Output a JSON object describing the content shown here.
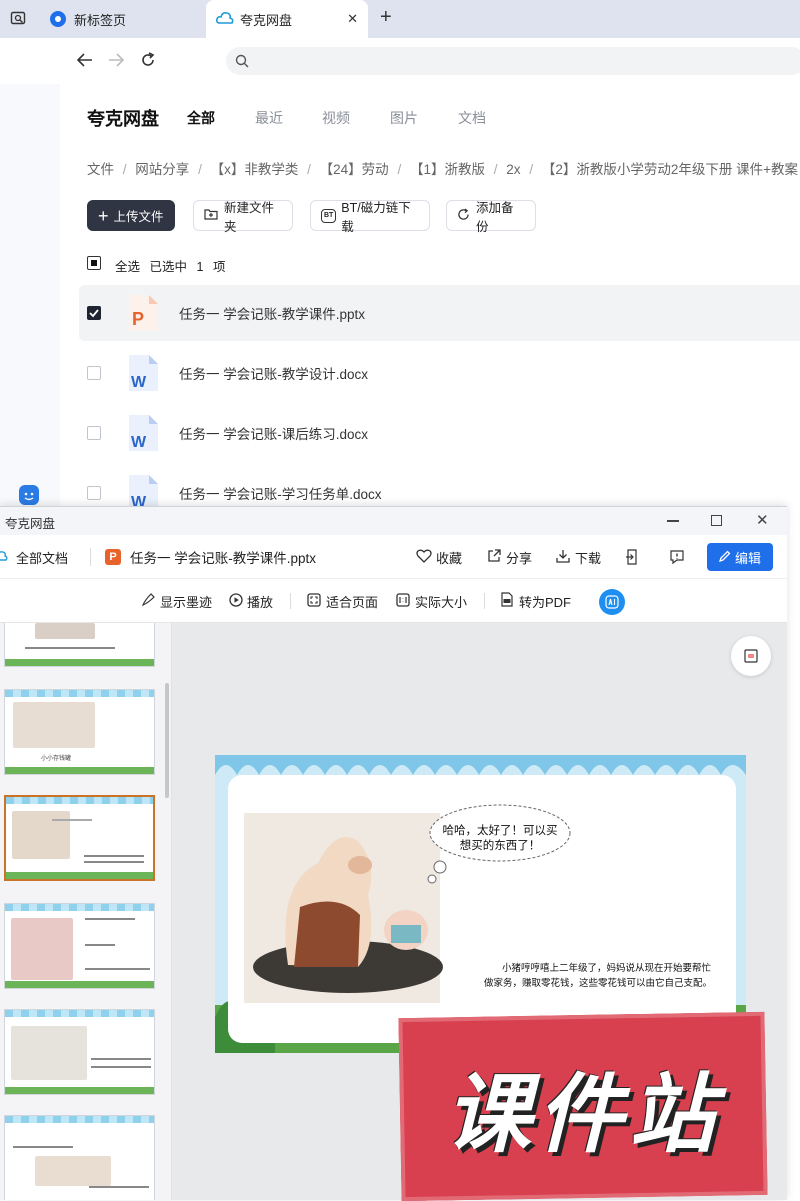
{
  "browser": {
    "tabs": [
      {
        "label": "新标签页"
      },
      {
        "label": "夸克网盘",
        "active": true
      }
    ],
    "new_tab_symbol": "+",
    "close_symbol": "✕"
  },
  "app": {
    "logo": "夸克网盘",
    "nav_tabs": [
      "全部",
      "最近",
      "视频",
      "图片",
      "文档"
    ],
    "active_tab": "全部",
    "breadcrumb": [
      "文件",
      "网站分享",
      "【x】非教学类",
      "【24】劳动",
      "【1】浙教版",
      "2x",
      "【2】浙教版小学劳动2年级下册 课件+教案"
    ],
    "breadcrumb_sep": "/",
    "actions": {
      "upload": "上传文件",
      "new_folder": "新建文件夹",
      "bt_download": "BT/磁力链下载",
      "add_backup": "添加备份"
    },
    "selection": {
      "select_all": "全选",
      "selected_prefix": "已选中",
      "count": "1",
      "unit": "项"
    },
    "files": [
      {
        "name": "任务一 学会记账-教学课件.pptx",
        "type": "pptx",
        "checked": true
      },
      {
        "name": "任务一 学会记账-教学设计.docx",
        "type": "docx",
        "checked": false
      },
      {
        "name": "任务一 学会记账-课后练习.docx",
        "type": "docx",
        "checked": false
      },
      {
        "name": "任务一 学会记账-学习任务单.docx",
        "type": "docx",
        "checked": false
      }
    ]
  },
  "viewer": {
    "window_title": "夸克网盘",
    "all_docs": "全部文档",
    "file_name": "任务一 学会记账-教学课件.pptx",
    "top_actions": {
      "favorite": "收藏",
      "share": "分享",
      "download": "下载",
      "edit": "编辑"
    },
    "tools": {
      "ink": "显示墨迹",
      "play": "播放",
      "fit_page": "适合页面",
      "actual_size": "实际大小",
      "to_pdf": "转为PDF"
    },
    "thumb_captions": [
      "小小存钱罐"
    ],
    "slide": {
      "bubble": "哈哈，太好了！可以买想买的东西了！",
      "body": "小猪哼哼嘻上二年级了，妈妈说从现在开始要帮忙做家务，赚取零花钱，这些零花钱可以由它自己支配。"
    },
    "watermark": "课件站"
  },
  "colors": {
    "accent": "#1f6feb",
    "upload_btn": "#2f3542",
    "tab_bar": "#dee3ef",
    "ppt": "#e8632b",
    "word": "#2b66c8",
    "stamp": "#d8404f"
  }
}
